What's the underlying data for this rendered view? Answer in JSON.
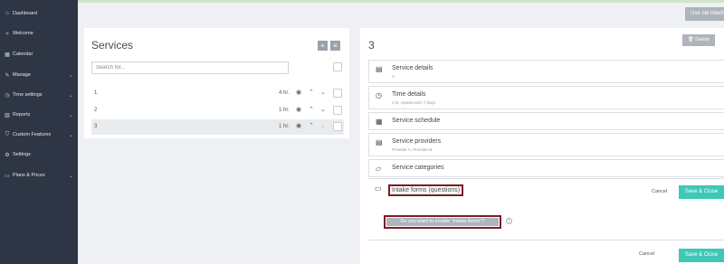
{
  "sidebar": {
    "items": [
      {
        "icon": "dashboard-icon",
        "glyph": "⌂",
        "label": "Dashboard",
        "chevron": false
      },
      {
        "icon": "lightbulb-icon",
        "glyph": "✧",
        "label": "Welcome",
        "chevron": false
      },
      {
        "icon": "calendar-icon",
        "glyph": "▦",
        "label": "Calendar",
        "chevron": false
      },
      {
        "icon": "pencil-icon",
        "glyph": "✎",
        "label": "Manage",
        "chevron": true
      },
      {
        "icon": "clock-icon",
        "glyph": "◷",
        "label": "Time settings",
        "chevron": true
      },
      {
        "icon": "bar-chart-icon",
        "glyph": "▥",
        "label": "Reports",
        "chevron": true
      },
      {
        "icon": "shield-icon",
        "glyph": "⛉",
        "label": "Custom Features",
        "chevron": true
      },
      {
        "icon": "gears-icon",
        "glyph": "⚙",
        "label": "Settings",
        "chevron": false
      },
      {
        "icon": "credit-card-icon",
        "glyph": "▭",
        "label": "Plans & Prices",
        "chevron": true
      }
    ]
  },
  "top": {
    "old_interface_label": "Use old interface"
  },
  "services": {
    "title": "Services",
    "add_glyph": "+",
    "menu_glyph": "≡",
    "search_placeholder": "Search for...",
    "rows": [
      {
        "name": "1",
        "duration": "4 hr."
      },
      {
        "name": "2",
        "duration": "1 hr."
      },
      {
        "name": "3",
        "duration": "1 hr."
      }
    ],
    "selected_index": 2
  },
  "detail": {
    "title": "3",
    "delete_label": "Delete",
    "delete_glyph": "🗑",
    "sections": {
      "service_details": {
        "title": "Service details",
        "subtitle": "3",
        "glyph": "▤"
      },
      "time_details": {
        "title": "Time details",
        "subtitle": "1 hr, repeat each 7 days",
        "glyph": "◷"
      },
      "schedule": {
        "title": "Service schedule",
        "glyph": "▦"
      },
      "providers": {
        "title": "Service providers",
        "subtitle": "Provider A, Provider B",
        "glyph": "▤"
      },
      "categories": {
        "title": "Service categories",
        "glyph": "▱"
      }
    },
    "intake": {
      "title": "Intake forms (questions)",
      "glyph": "▭",
      "cancel_label": "Cancel",
      "save_label": "Save & Close",
      "question": "Do you want to enable \"intake forms\"?",
      "info_glyph": "i",
      "cancel_label_2": "Cancel",
      "save_label_2": "Save & Close"
    }
  },
  "colors": {
    "sidebar": "#2e3646",
    "accent": "#3ec8b5",
    "highlight_border": "#7e1c24"
  }
}
